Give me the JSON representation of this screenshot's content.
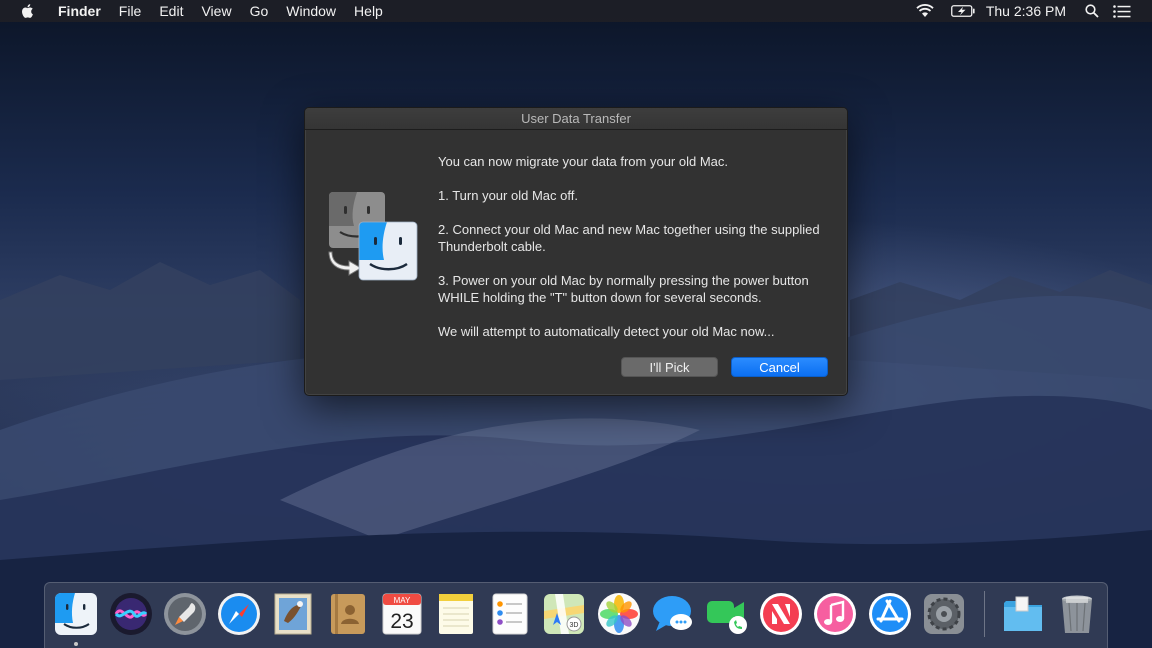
{
  "menubar": {
    "app_name": "Finder",
    "items": [
      "File",
      "Edit",
      "View",
      "Go",
      "Window",
      "Help"
    ],
    "clock": "Thu 2:36 PM",
    "status_icons": [
      "wifi-icon",
      "battery-charging-icon",
      "spotlight-search-icon",
      "notification-center-icon"
    ]
  },
  "dialog": {
    "title": "User Data Transfer",
    "paragraphs": [
      "You can now migrate your data from your old Mac.",
      "1. Turn your old Mac off.",
      "2. Connect your old Mac and new Mac together using the supplied Thunderbolt cable.",
      "3. Power on your old Mac by normally pressing the power button WHILE holding the \"T\" button down for several seconds.",
      "We will attempt to automatically detect your old Mac now..."
    ],
    "buttons": {
      "pick": "I'll Pick",
      "cancel": "Cancel"
    }
  },
  "dock": {
    "calendar_month": "MAY",
    "calendar_day": "23",
    "apps": [
      "Finder",
      "Siri",
      "Launchpad",
      "Safari",
      "Mail",
      "Contacts",
      "Calendar",
      "Notes",
      "Reminders",
      "Maps",
      "Photos",
      "Messages",
      "FaceTime",
      "News",
      "iTunes",
      "App Store",
      "System Preferences",
      "Downloads",
      "Trash"
    ]
  },
  "colors": {
    "accent": "#0b6ff1",
    "dialog_bg": "#323232",
    "menubar_bg": "#1e2026"
  }
}
